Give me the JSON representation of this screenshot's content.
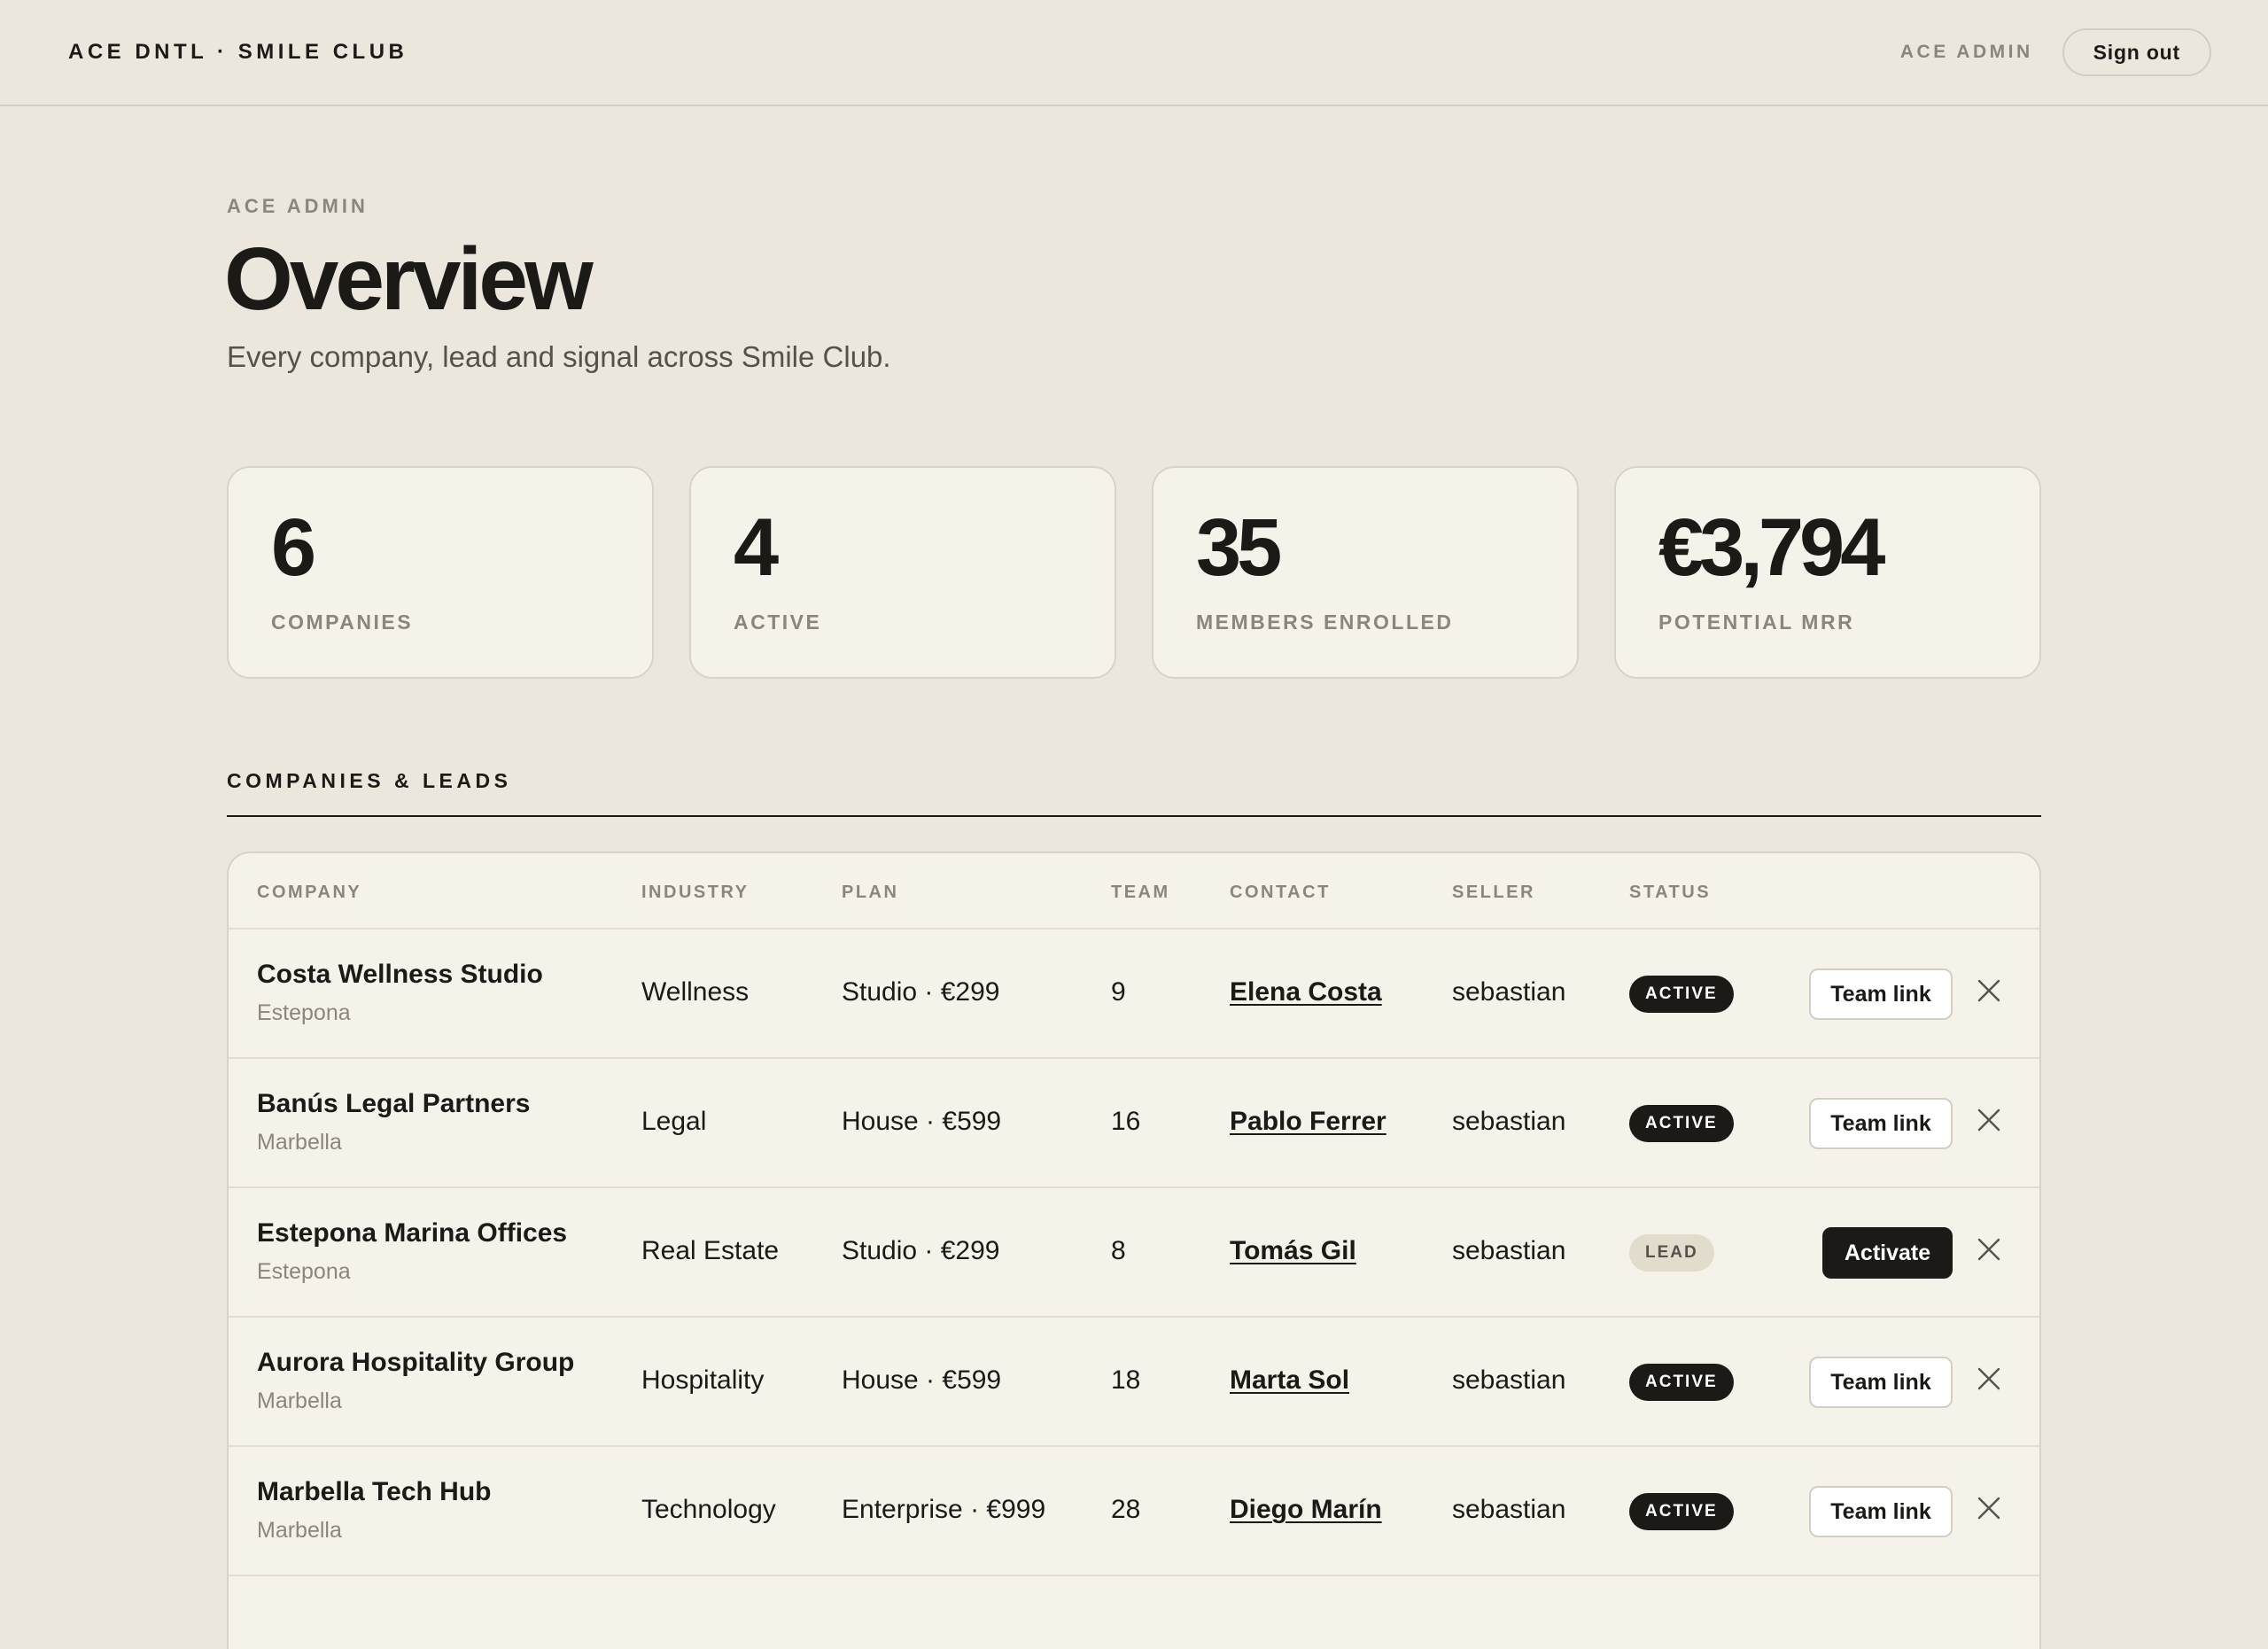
{
  "header": {
    "brand": "ACE DNTL · SMILE CLUB",
    "user_label": "ACE ADMIN",
    "signout_label": "Sign out"
  },
  "page": {
    "eyebrow": "ACE ADMIN",
    "title": "Overview",
    "subtitle": "Every company, lead and signal across Smile Club."
  },
  "stats": [
    {
      "value": "6",
      "label": "COMPANIES"
    },
    {
      "value": "4",
      "label": "ACTIVE"
    },
    {
      "value": "35",
      "label": "MEMBERS ENROLLED"
    },
    {
      "value": "€3,794",
      "label": "POTENTIAL MRR"
    }
  ],
  "section": {
    "title": "COMPANIES & LEADS"
  },
  "table": {
    "headers": {
      "company": "COMPANY",
      "industry": "INDUSTRY",
      "plan": "PLAN",
      "team": "TEAM",
      "contact": "CONTACT",
      "seller": "SELLER",
      "status": "STATUS"
    },
    "rows": [
      {
        "company": "Costa Wellness Studio",
        "city": "Estepona",
        "industry": "Wellness",
        "plan": "Studio · €299",
        "team": "9",
        "contact": "Elena Costa",
        "seller": "sebastian",
        "status": "ACTIVE",
        "action": "Team link"
      },
      {
        "company": "Banús Legal Partners",
        "city": "Marbella",
        "industry": "Legal",
        "plan": "House · €599",
        "team": "16",
        "contact": "Pablo Ferrer",
        "seller": "sebastian",
        "status": "ACTIVE",
        "action": "Team link"
      },
      {
        "company": "Estepona Marina Offices",
        "city": "Estepona",
        "industry": "Real Estate",
        "plan": "Studio · €299",
        "team": "8",
        "contact": "Tomás Gil",
        "seller": "sebastian",
        "status": "LEAD",
        "action": "Activate"
      },
      {
        "company": "Aurora Hospitality Group",
        "city": "Marbella",
        "industry": "Hospitality",
        "plan": "House · €599",
        "team": "18",
        "contact": "Marta Sol",
        "seller": "sebastian",
        "status": "ACTIVE",
        "action": "Team link"
      },
      {
        "company": "Marbella Tech Hub",
        "city": "Marbella",
        "industry": "Technology",
        "plan": "Enterprise · €999",
        "team": "28",
        "contact": "Diego Marín",
        "seller": "sebastian",
        "status": "ACTIVE",
        "action": "Team link"
      }
    ]
  },
  "icons": {
    "row_remove": "close-icon"
  },
  "colors": {
    "background": "#ebe7dd",
    "card": "#f5f2ea",
    "ink": "#1b1a17",
    "muted": "#8a867b",
    "lead_badge": "#e2dccd"
  }
}
